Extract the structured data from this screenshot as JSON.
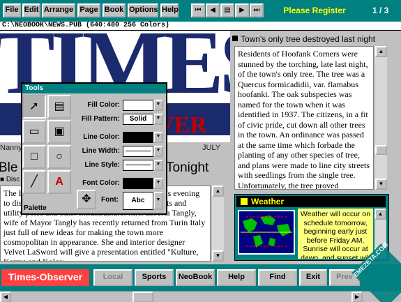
{
  "menubar": {
    "menus": [
      "File",
      "Edit",
      "Arrange",
      "Page",
      "Book",
      "Options",
      "Help"
    ],
    "nav": [
      "⏮",
      "◀",
      "▤",
      "▶",
      "⏭"
    ],
    "register_text": "Please Register",
    "page_indicator": "1 / 3"
  },
  "pathbar": {
    "path": "C:\\NEOBOOK\\NEWS.PUB (640:480 256 Colors)"
  },
  "masthead": {
    "big_text": "TIMES",
    "red_text": "VER",
    "nanny": "Nanny",
    "date": "JULY"
  },
  "headline": {
    "left": "Ble",
    "right": "Tonight",
    "disc": "■ Disc"
  },
  "left_story": {
    "text": "The Bleaving Town Council will meet at 8:30 this evening to discuss selection of new colors for fire hydrants and utility poles and other infrastructure. Mrs. Elberta Tangly, wife of Mayor Tangly has recently returned from Turin Italy just full of new ideas for making the town more cosmopolitan in appearance. She and interior designer Velvet LaSword will give a presentation entitled \"Kulture, Karma and Kolor:"
  },
  "right_story": {
    "title": "Town's only tree destroyed last night",
    "text": "Residents of Hoofank Corners were stunned by the torching, late last night, of the town's only tree. The tree was a Quercus formicadidii, var. flamabus hoofanki. The oak subspecies was named for the town when it was identified in 1937. The citizens, in a fit of civic pride, cut down all other trees in the town. An ordinance was passed at the same time which forbade the planting of any other species of tree, and plans were made to line city streets with seedlings from the single tree. Unfortunately, the tree proved"
  },
  "weather": {
    "title": "Weather",
    "text": "Weather will occur on schedule tomorrow, beginning early just before Friday AM. Sunrise will occur at dawn, and sunset will"
  },
  "tools": {
    "title": "Tools",
    "labels": {
      "fill_color": "Fill Color:",
      "fill_pattern": "Fill Pattern:",
      "line_color": "Line Color:",
      "line_width": "Line Width:",
      "line_style": "Line Style:",
      "font_color": "Font Color:",
      "font": "Font:"
    },
    "values": {
      "fill_pattern": "Solid",
      "font": "Abc"
    },
    "palette": "Palette"
  },
  "bottombar": {
    "brand": "Times-Observer",
    "buttons": [
      "Local",
      "Sports",
      "NeoBook",
      "Help",
      "Find",
      "Exit",
      "Prev"
    ]
  },
  "watermark": "EMEZETA.COM",
  "colors": {
    "teal": "#008080",
    "brand_red": "#ff4040",
    "register_yellow": "#ffff00",
    "weather_bg": "#ffff80"
  }
}
